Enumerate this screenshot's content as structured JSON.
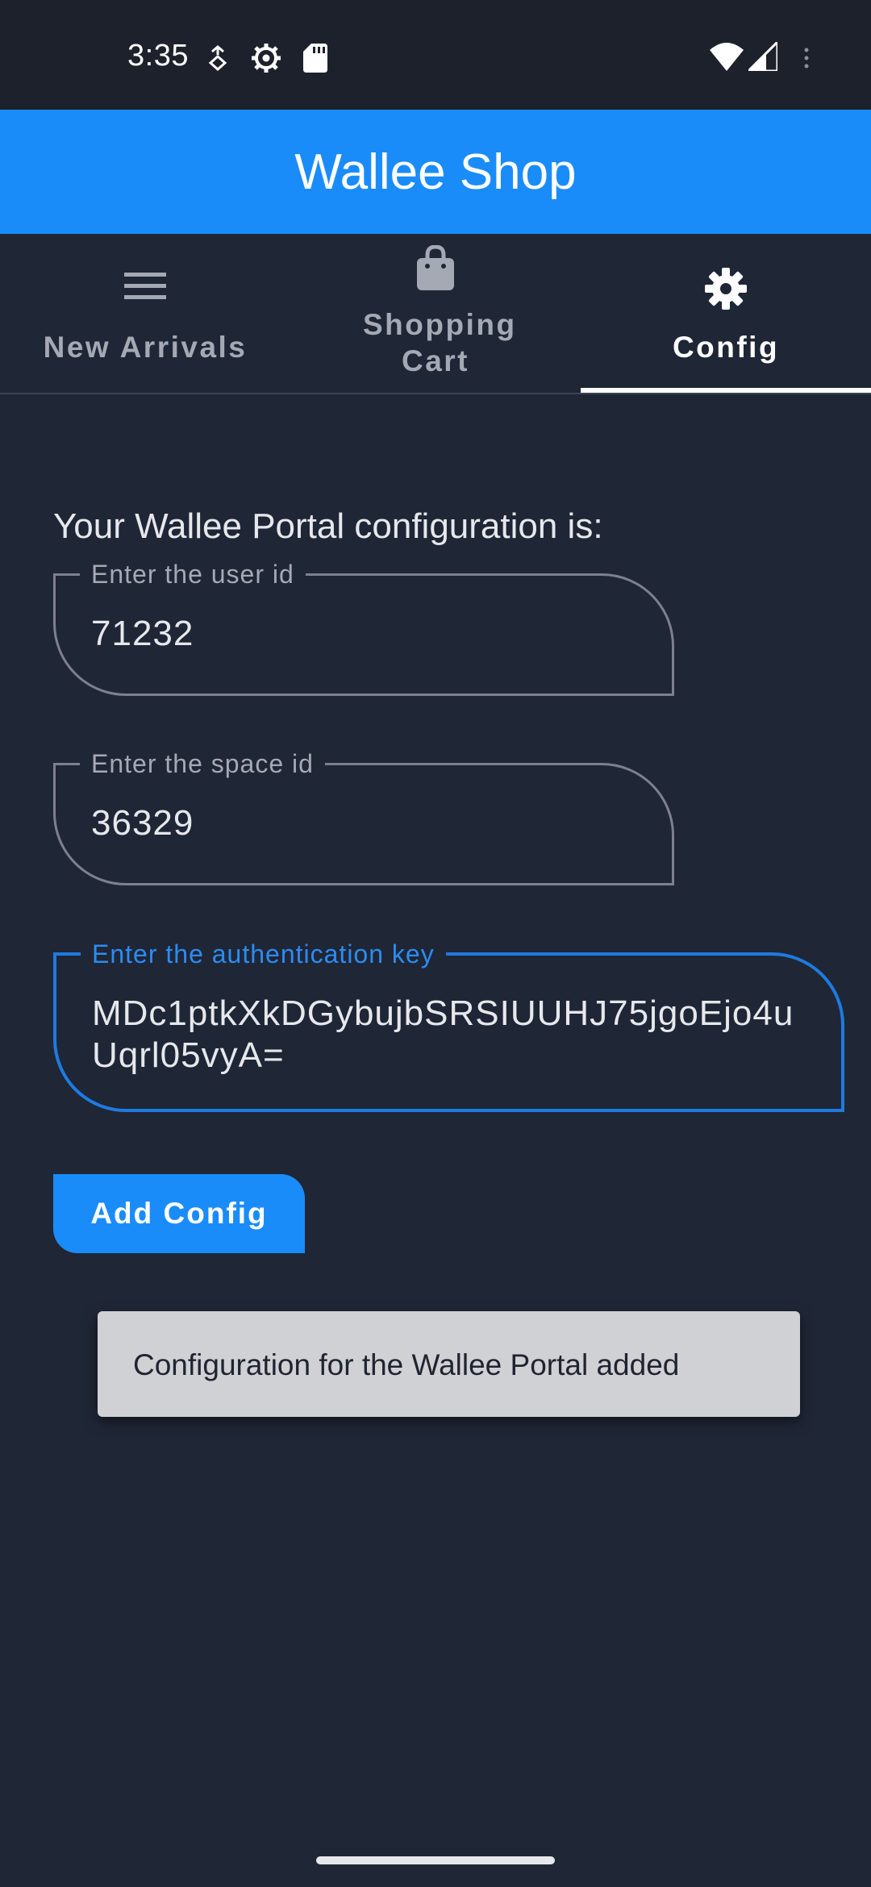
{
  "status_bar": {
    "time": "3:35",
    "icons": [
      "data-saver-icon",
      "settings-icon",
      "sd-card-icon",
      "wifi-icon",
      "signal-icon",
      "more-icon"
    ]
  },
  "app": {
    "title": "Wallee Shop"
  },
  "tabs": [
    {
      "label": "New Arrivals",
      "icon": "menu-icon",
      "active": false
    },
    {
      "label": "Shopping Cart",
      "icon": "shopping-bag-icon",
      "active": false
    },
    {
      "label": "Config",
      "icon": "gear-icon",
      "active": true
    }
  ],
  "config": {
    "heading": "Your Wallee Portal configuration is:",
    "user_id": {
      "label": "Enter the user id",
      "value": "71232"
    },
    "space_id": {
      "label": "Enter the space id",
      "value": "36329"
    },
    "auth_key": {
      "label": "Enter the authentication key",
      "value": "MDc1ptkXkDGybujbSRSIUUHJ75jgoEjo4uUqrl05vyA="
    },
    "button_label": "Add Config"
  },
  "snackbar": {
    "message": "Configuration for the Wallee Portal added"
  },
  "colors": {
    "accent": "#1a8cfa",
    "background": "#1f2636",
    "focus": "#1e7be0",
    "snackbar": "#d0d1d5"
  }
}
